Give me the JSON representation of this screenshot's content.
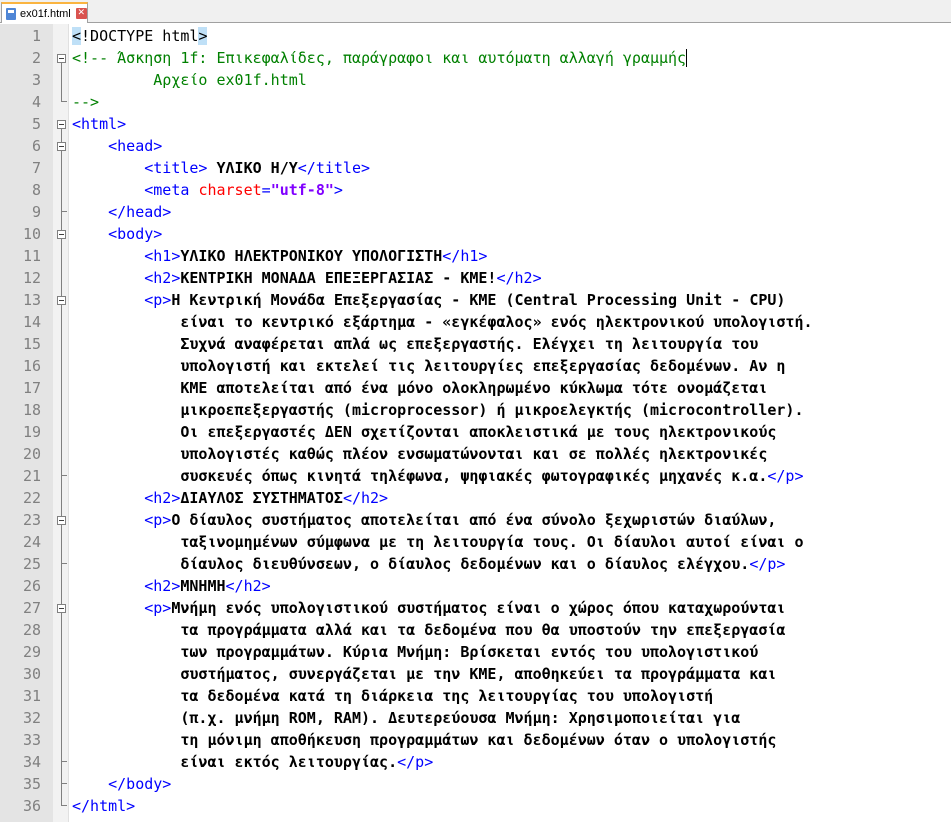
{
  "tab": {
    "filename": "ex01f.html",
    "close_glyph": "✕",
    "icon": "save-file-icon"
  },
  "editor": {
    "line_numbers": [
      "1",
      "2",
      "3",
      "4",
      "5",
      "6",
      "7",
      "8",
      "9",
      "10",
      "11",
      "12",
      "13",
      "14",
      "15",
      "16",
      "17",
      "18",
      "19",
      "20",
      "21",
      "22",
      "23",
      "24",
      "25",
      "26",
      "27",
      "28",
      "29",
      "30",
      "31",
      "32",
      "33",
      "34",
      "35",
      "36"
    ],
    "lines": [
      [
        {
          "t": "<",
          "c": "hl"
        },
        {
          "t": "!DOCTYPE html",
          "c": "doctype"
        },
        {
          "t": ">",
          "c": "hl"
        }
      ],
      [
        {
          "t": "<!-- Άσκηση 1f: Επικεφαλίδες, παράγραφοι και αυτόματη αλλαγή γραμμής",
          "c": "cmt"
        }
      ],
      [
        {
          "t": "         Αρχείο ex01f.html",
          "c": "cmt"
        }
      ],
      [
        {
          "t": "-->",
          "c": "cmt"
        }
      ],
      [
        {
          "t": "<html>",
          "c": "tag"
        }
      ],
      [
        {
          "t": "    ",
          "c": ""
        },
        {
          "t": "<head>",
          "c": "tag"
        }
      ],
      [
        {
          "t": "        ",
          "c": ""
        },
        {
          "t": "<title>",
          "c": "tag"
        },
        {
          "t": " ΥΛΙΚΟ Η/Υ",
          "c": "txt"
        },
        {
          "t": "</title>",
          "c": "tag"
        }
      ],
      [
        {
          "t": "        ",
          "c": ""
        },
        {
          "t": "<meta ",
          "c": "tag"
        },
        {
          "t": "charset",
          "c": "attr"
        },
        {
          "t": "=",
          "c": "tag"
        },
        {
          "t": "\"utf-8\"",
          "c": "val"
        },
        {
          "t": ">",
          "c": "tag"
        }
      ],
      [
        {
          "t": "    ",
          "c": ""
        },
        {
          "t": "</head>",
          "c": "tag"
        }
      ],
      [
        {
          "t": "    ",
          "c": ""
        },
        {
          "t": "<body>",
          "c": "tag"
        }
      ],
      [
        {
          "t": "        ",
          "c": ""
        },
        {
          "t": "<h1>",
          "c": "tag"
        },
        {
          "t": "ΥΛΙΚΟ ΗΛΕΚΤΡΟΝΙΚΟΥ ΥΠΟΛΟΓΙΣΤΗ",
          "c": "txt"
        },
        {
          "t": "</h1>",
          "c": "tag"
        }
      ],
      [
        {
          "t": "        ",
          "c": ""
        },
        {
          "t": "<h2>",
          "c": "tag"
        },
        {
          "t": "ΚΕΝΤΡΙΚΗ ΜΟΝΑΔΑ ΕΠΕΞΕΡΓΑΣΙΑΣ - ΚΜΕ!",
          "c": "txt"
        },
        {
          "t": "</h2>",
          "c": "tag"
        }
      ],
      [
        {
          "t": "        ",
          "c": ""
        },
        {
          "t": "<p>",
          "c": "tag"
        },
        {
          "t": "Η Κεντρική Μονάδα Επεξεργασίας - ΚΜΕ (Central Processing Unit - CPU)",
          "c": "txt"
        }
      ],
      [
        {
          "t": "            είναι το κεντρικό εξάρτημα - «εγκέφαλος» ενός ηλεκτρονικού υπολογιστή.",
          "c": "txt"
        }
      ],
      [
        {
          "t": "            Συχνά αναφέρεται απλά ως επεξεργαστής. Ελέγχει τη λειτουργία του",
          "c": "txt"
        }
      ],
      [
        {
          "t": "            υπολογιστή και εκτελεί τις λειτουργίες επεξεργασίας δεδομένων. Αν η",
          "c": "txt"
        }
      ],
      [
        {
          "t": "            ΚΜΕ αποτελείται από ένα μόνο ολοκληρωμένο κύκλωμα τότε ονομάζεται",
          "c": "txt"
        }
      ],
      [
        {
          "t": "            μικροεπεξεργαστής (microprocessor) ή μικροελεγκτής (microcontroller).",
          "c": "txt"
        }
      ],
      [
        {
          "t": "            Οι επεξεργαστές ΔΕΝ σχετίζονται αποκλειστικά με τους ηλεκτρονικούς",
          "c": "txt"
        }
      ],
      [
        {
          "t": "            υπολογιστές καθώς πλέον ενσωματώνονται και σε πολλές ηλεκτρονικές",
          "c": "txt"
        }
      ],
      [
        {
          "t": "            συσκευές όπως κινητά τηλέφωνα, ψηφιακές φωτογραφικές μηχανές κ.α.",
          "c": "txt"
        },
        {
          "t": "</p>",
          "c": "tag"
        }
      ],
      [
        {
          "t": "        ",
          "c": ""
        },
        {
          "t": "<h2>",
          "c": "tag"
        },
        {
          "t": "ΔΙΑΥΛΟΣ ΣΥΣΤΗΜΑΤΟΣ",
          "c": "txt"
        },
        {
          "t": "</h2>",
          "c": "tag"
        }
      ],
      [
        {
          "t": "        ",
          "c": ""
        },
        {
          "t": "<p>",
          "c": "tag"
        },
        {
          "t": "Ο δίαυλος συστήματος αποτελείται από ένα σύνολο ξεχωριστών διαύλων,",
          "c": "txt"
        }
      ],
      [
        {
          "t": "            ταξινομημένων σύμφωνα με τη λειτουργία τους. Οι δίαυλοι αυτοί είναι ο",
          "c": "txt"
        }
      ],
      [
        {
          "t": "            δίαυλος διευθύνσεων, ο δίαυλος δεδομένων και ο δίαυλος ελέγχου.",
          "c": "txt"
        },
        {
          "t": "</p>",
          "c": "tag"
        }
      ],
      [
        {
          "t": "        ",
          "c": ""
        },
        {
          "t": "<h2>",
          "c": "tag"
        },
        {
          "t": "ΜΝΗΜΗ",
          "c": "txt"
        },
        {
          "t": "</h2>",
          "c": "tag"
        }
      ],
      [
        {
          "t": "        ",
          "c": ""
        },
        {
          "t": "<p>",
          "c": "tag"
        },
        {
          "t": "Μνήμη ενός υπολογιστικού συστήματος είναι ο χώρος όπου καταχωρούνται",
          "c": "txt"
        }
      ],
      [
        {
          "t": "            τα προγράμματα αλλά και τα δεδομένα που θα υποστούν την επεξεργασία",
          "c": "txt"
        }
      ],
      [
        {
          "t": "            των προγραμμάτων. Κύρια Μνήμη: Βρίσκεται εντός του υπολογιστικού",
          "c": "txt"
        }
      ],
      [
        {
          "t": "            συστήματος, συνεργάζεται με την ΚΜΕ, αποθηκεύει τα προγράμματα και",
          "c": "txt"
        }
      ],
      [
        {
          "t": "            τα δεδομένα κατά τη διάρκεια της λειτουργίας του υπολογιστή",
          "c": "txt"
        }
      ],
      [
        {
          "t": "            (π.χ. μνήμη ROM, RAM). Δευτερεύουσα Μνήμη: Χρησιμοποιείται για",
          "c": "txt"
        }
      ],
      [
        {
          "t": "            τη μόνιμη αποθήκευση προγραμμάτων και δεδομένων όταν ο υπολογιστής",
          "c": "txt"
        }
      ],
      [
        {
          "t": "            είναι εκτός λειτουργίας.",
          "c": "txt"
        },
        {
          "t": "</p>",
          "c": "tag"
        }
      ],
      [
        {
          "t": "    ",
          "c": ""
        },
        {
          "t": "</body>",
          "c": "tag"
        }
      ],
      [
        {
          "t": "</html>",
          "c": "tag"
        }
      ]
    ]
  }
}
